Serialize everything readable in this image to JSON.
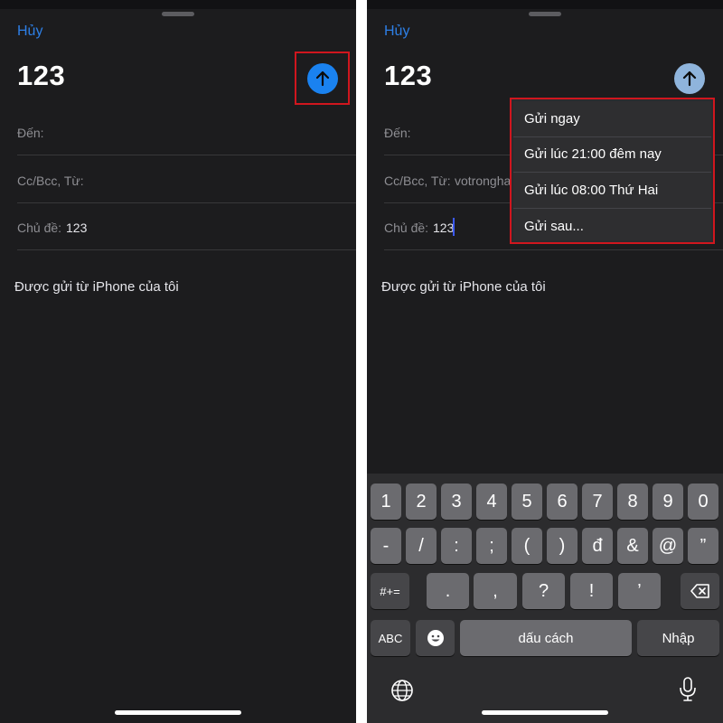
{
  "colors": {
    "accent": "#2d7fe6",
    "send_button": "#1a82f0",
    "highlight": "#d0161e",
    "background": "#1c1c1e"
  },
  "compose": {
    "cancel_label": "Hủy",
    "subject_title": "123",
    "to_label": "Đến:",
    "cc_label": "Cc/Bcc, Từ:",
    "from_value": "votrongha",
    "subject_label": "Chủ đề:",
    "subject_value": "123",
    "signature": "Được gửi từ iPhone của tôi",
    "send_icon": "arrow-up-icon"
  },
  "send_menu": {
    "items": [
      "Gửi ngay",
      "Gửi lúc 21:00 đêm nay",
      "Gửi lúc 08:00 Thứ Hai",
      "Gửi sau..."
    ]
  },
  "keyboard": {
    "row1": [
      "1",
      "2",
      "3",
      "4",
      "5",
      "6",
      "7",
      "8",
      "9",
      "0"
    ],
    "row2": [
      "-",
      "/",
      ":",
      ";",
      "(",
      ")",
      "đ",
      "&",
      "@",
      "”"
    ],
    "row3_mode": "#+=",
    "row3": [
      ".",
      ",",
      "?",
      "!",
      "’"
    ],
    "abc": "ABC",
    "space": "dấu cách",
    "return": "Nhập",
    "icons": [
      "emoji-icon",
      "backspace-icon",
      "globe-icon",
      "microphone-icon"
    ]
  }
}
